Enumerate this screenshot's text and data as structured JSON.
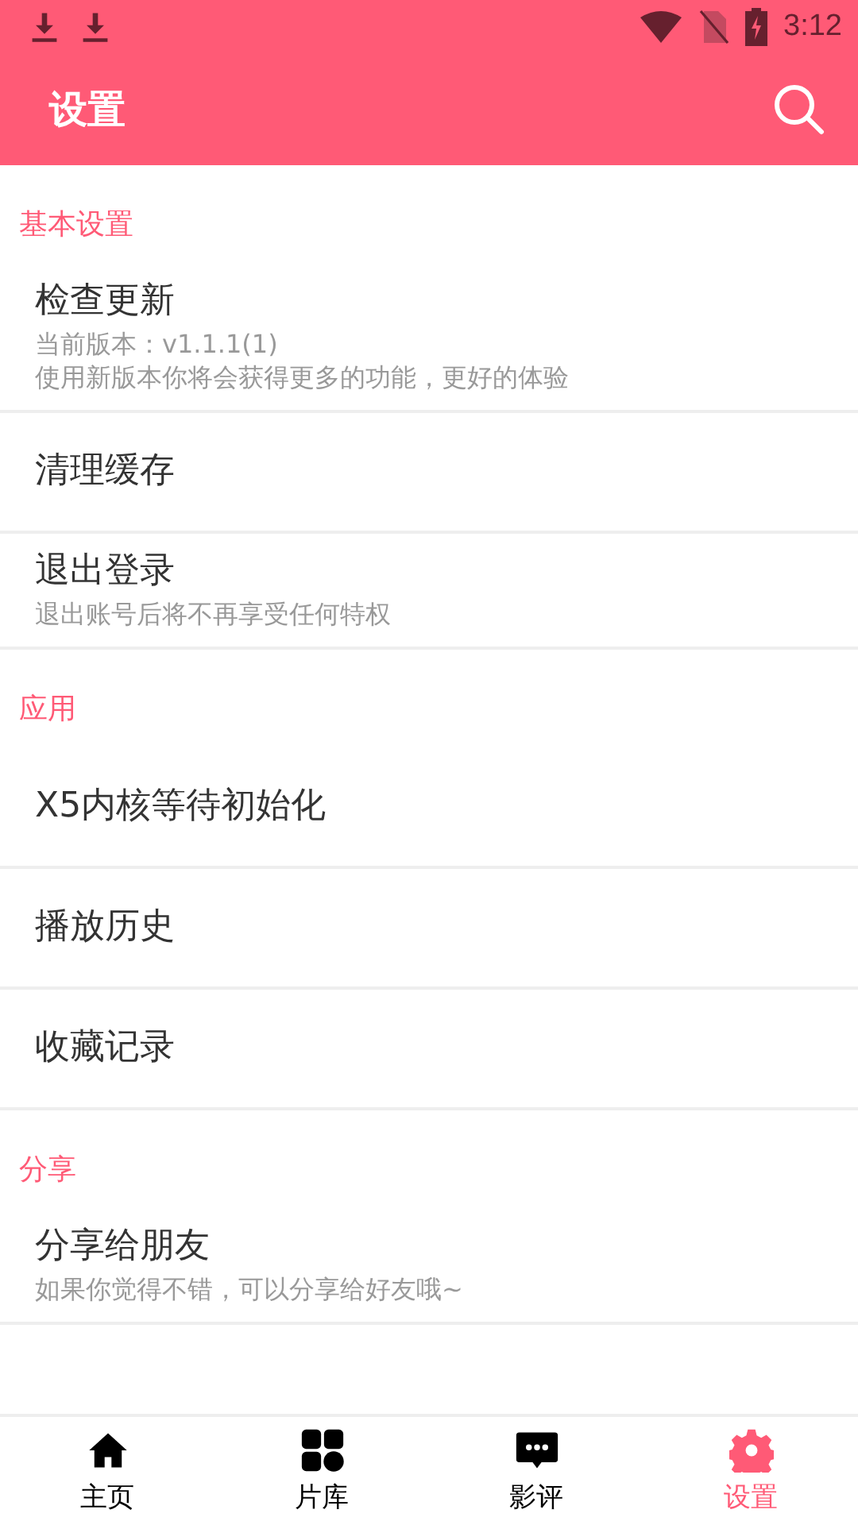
{
  "status_bar": {
    "time": "3:12"
  },
  "app_bar": {
    "title": "设置"
  },
  "sections": [
    {
      "header": "基本设置",
      "items": [
        {
          "title": "检查更新",
          "summary": [
            "当前版本：v1.1.1(1)",
            "使用新版本你将会获得更多的功能，更好的体验"
          ]
        },
        {
          "title": "清理缓存"
        },
        {
          "title": "退出登录",
          "summary": [
            "退出账号后将不再享受任何特权"
          ]
        }
      ]
    },
    {
      "header": "应用",
      "items": [
        {
          "title": "X5内核等待初始化"
        },
        {
          "title": "播放历史"
        },
        {
          "title": "收藏记录"
        }
      ]
    },
    {
      "header": "分享",
      "items": [
        {
          "title": "分享给朋友",
          "summary": [
            "如果你觉得不错，可以分享给好友哦~"
          ]
        }
      ]
    }
  ],
  "bottom_nav": [
    {
      "kind": "home",
      "label": "主页",
      "selected": false
    },
    {
      "kind": "grid",
      "label": "片库",
      "selected": false
    },
    {
      "kind": "chat",
      "label": "影评",
      "selected": false
    },
    {
      "kind": "settings",
      "label": "设置",
      "selected": true
    }
  ]
}
